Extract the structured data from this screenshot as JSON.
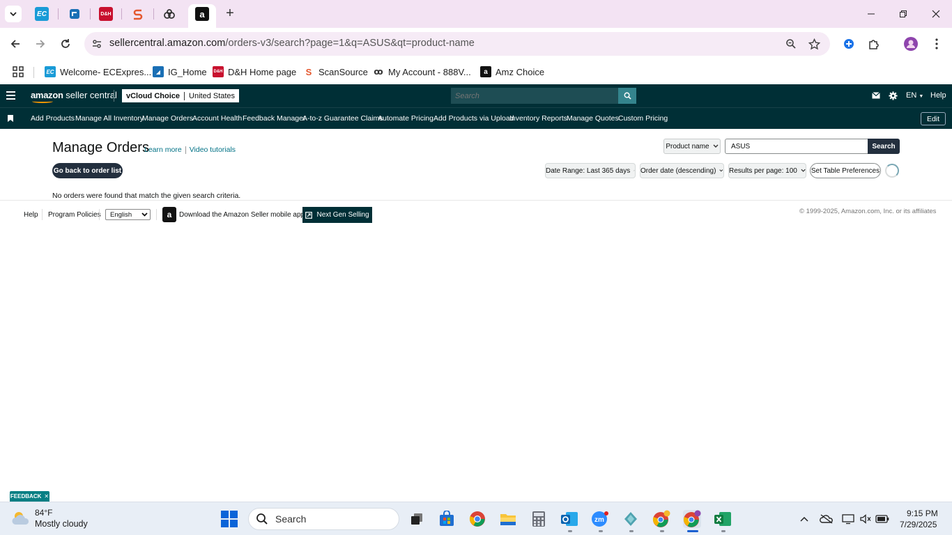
{
  "browser": {
    "tabs": [
      {
        "icon": "ecexpress-icon",
        "label": "EC"
      },
      {
        "icon": "ingram-icon",
        "label": ""
      },
      {
        "icon": "dh-icon",
        "label": "D&H"
      },
      {
        "icon": "scansource-icon",
        "label": ""
      },
      {
        "icon": "myaccount-icon",
        "label": ""
      },
      {
        "icon": "amazon-icon",
        "label": "a"
      }
    ],
    "url_host": "sellercentral.amazon.com",
    "url_path": "/orders-v3/search?page=1&q=ASUS&qt=product-name",
    "bookmarks": [
      {
        "label": "Welcome- ECExpres...",
        "icon": "ecexpress-icon",
        "color": "#1a9bd7"
      },
      {
        "label": "IG_Home",
        "icon": "ingram-icon",
        "color": "#1a6fb5"
      },
      {
        "label": "D&H Home page",
        "icon": "dh-icon",
        "color": "#c8102e"
      },
      {
        "label": "ScanSource",
        "icon": "scansource-icon",
        "color": "#e4572e"
      },
      {
        "label": "My Account - 888V...",
        "icon": "myaccount-icon",
        "color": "#333333"
      },
      {
        "label": "Amz Choice",
        "icon": "amazon-icon",
        "color": "#111111"
      }
    ]
  },
  "header": {
    "logo_text": "amazon",
    "logo_sub": "seller central",
    "account_name": "vCloud Choice",
    "account_region": "United States",
    "search_placeholder": "Search",
    "language": "EN",
    "help": "Help"
  },
  "nav": {
    "links": [
      "Add Products",
      "Manage All Inventory",
      "Manage Orders",
      "Account Health",
      "Feedback Manager",
      "A-to-z Guarantee Claims",
      "Automate Pricing",
      "Add Products via Upload",
      "Inventory Reports",
      "Manage Quotes",
      "Custom Pricing"
    ],
    "edit": "Edit"
  },
  "page": {
    "title": "Manage Orders",
    "learn_more": "Learn more",
    "video_tutorials": "Video tutorials",
    "search_type": "Product name",
    "search_value": "ASUS",
    "search_button": "Search",
    "back_button": "Go back to order list",
    "date_range": "Date Range: Last 365 days",
    "sort": "Order date (descending)",
    "results_per_page": "Results per page: 100",
    "table_prefs": "Set Table Preferences",
    "empty_message": "No orders were found that match the given search criteria."
  },
  "footer": {
    "help": "Help",
    "program_policies": "Program Policies",
    "language": "English",
    "download_app": "Download the Amazon Seller mobile app",
    "next_gen": "Next Gen Selling",
    "copyright": "© 1999-2025, Amazon.com, Inc. or its affiliates"
  },
  "feedback": "FEEDBACK",
  "taskbar": {
    "temperature": "84°F",
    "weather": "Mostly cloudy",
    "search_placeholder": "Search",
    "time": "9:15 PM",
    "date": "7/29/2025"
  },
  "colors": {
    "amazon_header": "#002f36",
    "amazon_search_btn": "#34848d",
    "dark_button": "#232f3e",
    "link": "#007185",
    "chrome_tab_bg": "#f3e3f3"
  }
}
